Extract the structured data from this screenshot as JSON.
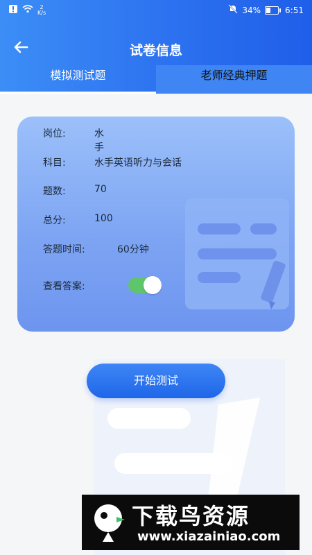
{
  "status": {
    "net_speed_top": "2",
    "net_speed_bottom": "K/s",
    "battery_pct": "34%",
    "time": "6:51"
  },
  "nav": {
    "title": "试卷信息",
    "back_icon": "arrow-left-icon"
  },
  "tabs": [
    {
      "label": "模拟测试题",
      "active": true
    },
    {
      "label": "老师经典押题",
      "active": false
    }
  ],
  "info": {
    "position_label": "岗位:",
    "position_value": "水手",
    "subject_label": "科目:",
    "subject_value": "水手英语听力与会话",
    "count_label": "题数:",
    "count_value": "70",
    "score_label": "总分:",
    "score_value": "100",
    "time_label": "答题时间:",
    "time_value": "60分钟",
    "answer_label": "查看答案:",
    "answer_toggle_on": true
  },
  "start_button": "开始测试",
  "watermark": {
    "title": "下载鸟资源",
    "url": "www.xiazainiao.com"
  },
  "colors": {
    "header": "#2f76f1",
    "toggle_on": "#5fc56a",
    "button": "#2b74ee"
  }
}
